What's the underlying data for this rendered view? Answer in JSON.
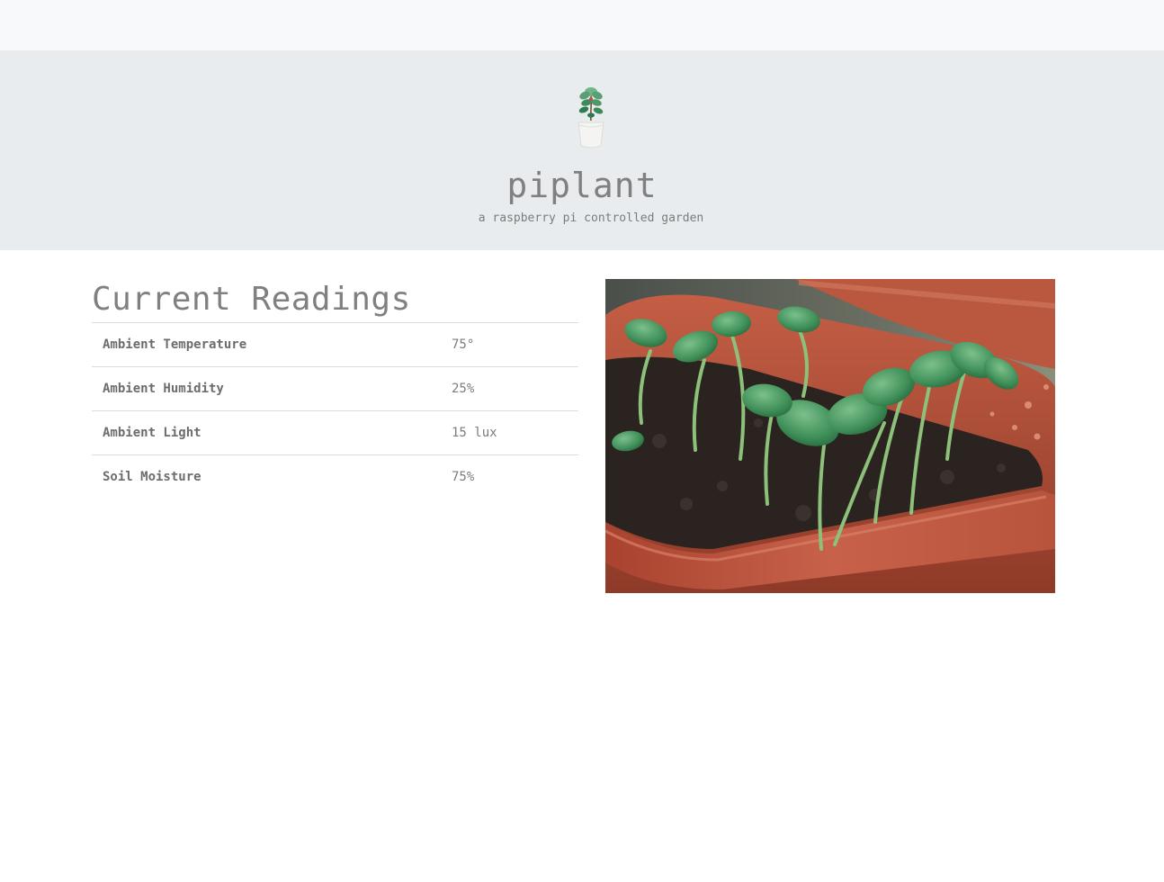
{
  "app": {
    "title": "piplant",
    "subtitle": "a raspberry pi controlled garden",
    "logo_icon": "potted-plant-icon"
  },
  "readings": {
    "title": "Current Readings",
    "rows": [
      {
        "label": "Ambient Temperature",
        "value": "75°"
      },
      {
        "label": "Ambient Humidity",
        "value": "25%"
      },
      {
        "label": "Ambient Light",
        "value": "15 lux"
      },
      {
        "label": "Soil Moisture",
        "value": "75%"
      }
    ]
  },
  "photo": {
    "subject_icon": "seedlings-photo"
  },
  "colors": {
    "hero_bg": "#e9ecef",
    "topbar_bg": "#f8f9fa",
    "text": "#7b7b7b",
    "pot": "#b5533c",
    "leaf": "#4f9a5e"
  }
}
